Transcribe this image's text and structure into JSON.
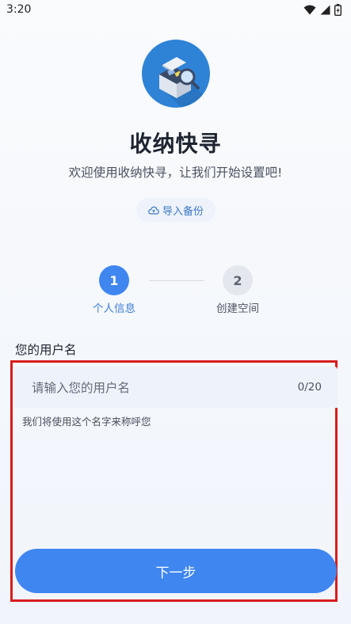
{
  "status_bar": {
    "time": "3:20",
    "icons": [
      "wifi-icon",
      "signal-icon",
      "battery-icon"
    ]
  },
  "app": {
    "title": "收纳快寻",
    "subtitle": "欢迎使用收纳快寻，让我们开始设置吧!",
    "logo_icon": "storage-box-search-icon"
  },
  "import_backup": {
    "label": "导入备份",
    "icon": "cloud-icon"
  },
  "stepper": {
    "steps": [
      {
        "number": "1",
        "label": "个人信息"
      },
      {
        "number": "2",
        "label": "创建空间"
      }
    ]
  },
  "form": {
    "field_label": "您的用户名",
    "placeholder": "请输入您的用户名",
    "value": "",
    "counter": "0/20",
    "helper": "我们将使用这个名字来称呼您"
  },
  "actions": {
    "next_label": "下一步"
  },
  "colors": {
    "primary": "#3f86f0",
    "logo_bg": "#2f83d6",
    "highlight_border": "#d91c1c"
  }
}
